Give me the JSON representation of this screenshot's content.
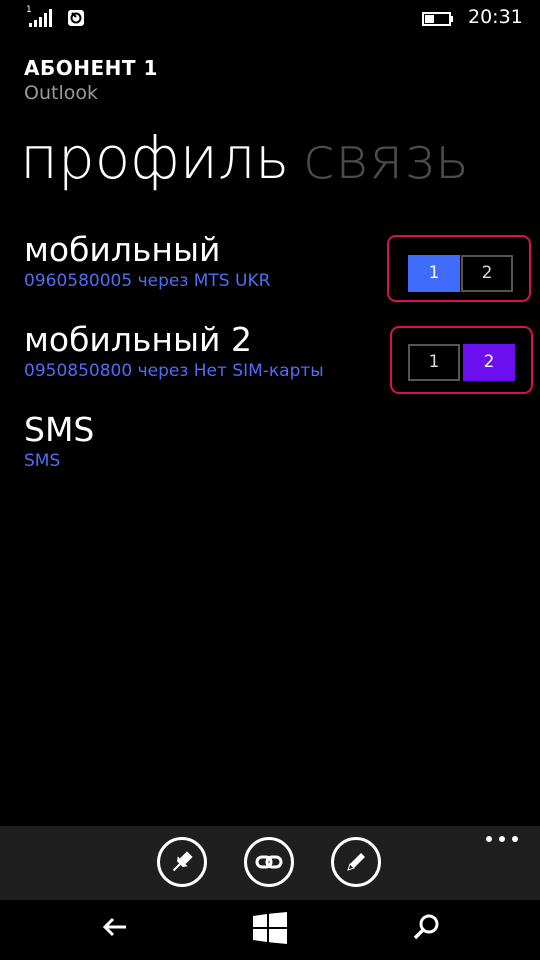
{
  "status_bar": {
    "sim_indicator": "1",
    "time": "20:31",
    "icons": [
      "signal-strength-icon",
      "data-sync-icon",
      "battery-icon"
    ]
  },
  "header": {
    "account_name": "АБОНЕНТ 1",
    "account_source": "Outlook"
  },
  "pivot": {
    "tabs": [
      {
        "label": "профиль",
        "active": true
      },
      {
        "label": "связь",
        "active": false
      }
    ]
  },
  "contact_methods": [
    {
      "label": "мобильный",
      "detail": "0960580005 через MTS UKR",
      "sim_options": [
        "1",
        "2"
      ],
      "selected_sim": "1"
    },
    {
      "label": "мобильный 2",
      "detail": "0950850800 через Нет SIM-карты",
      "sim_options": [
        "1",
        "2"
      ],
      "selected_sim": "2"
    },
    {
      "label": "SMS",
      "detail": "SMS"
    }
  ],
  "app_bar": {
    "buttons": [
      "pin-icon",
      "link-icon",
      "edit-icon"
    ],
    "more_icon": "ellipsis-icon"
  },
  "nav_bar": {
    "buttons": [
      "back-arrow-icon",
      "windows-logo-icon",
      "search-icon"
    ]
  },
  "colors": {
    "background": "#000000",
    "accent_blue": "#3f6cfa",
    "accent_purple": "#6b0fef",
    "highlight_frame": "#d6115a",
    "detail_text": "#4f6df5",
    "inactive_pivot": "#4b4b4b"
  }
}
